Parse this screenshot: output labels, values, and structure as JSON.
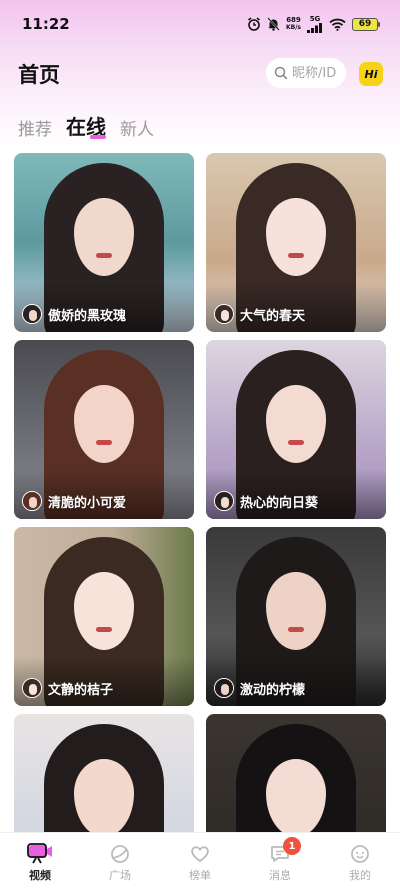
{
  "status_bar": {
    "time": "11:22",
    "net_speed_value": "689",
    "net_speed_unit": "KB/s",
    "network": "5G",
    "battery": "69"
  },
  "header": {
    "title": "首页",
    "search_placeholder": "昵称/ID",
    "hi_label": "Hi",
    "hi_color": "#f7d21b"
  },
  "tabs": [
    {
      "label": "推荐",
      "active": false
    },
    {
      "label": "在线",
      "active": true
    },
    {
      "label": "新人",
      "active": false
    }
  ],
  "accent_color": "#e95fe4",
  "cards": [
    {
      "nickname": "傲娇的黑玫瑰"
    },
    {
      "nickname": "大气的春天"
    },
    {
      "nickname": "清脆的小可爱"
    },
    {
      "nickname": "热心的向日葵"
    },
    {
      "nickname": "文静的桔子"
    },
    {
      "nickname": "激动的柠檬"
    },
    {
      "nickname": ""
    },
    {
      "nickname": ""
    }
  ],
  "bottom_nav": [
    {
      "label": "视频",
      "icon": "video-icon",
      "active": true
    },
    {
      "label": "广场",
      "icon": "planet-icon",
      "active": false
    },
    {
      "label": "榜单",
      "icon": "heart-icon",
      "active": false
    },
    {
      "label": "消息",
      "icon": "message-icon",
      "active": false,
      "badge": "1"
    },
    {
      "label": "我的",
      "icon": "profile-icon",
      "active": false
    }
  ]
}
